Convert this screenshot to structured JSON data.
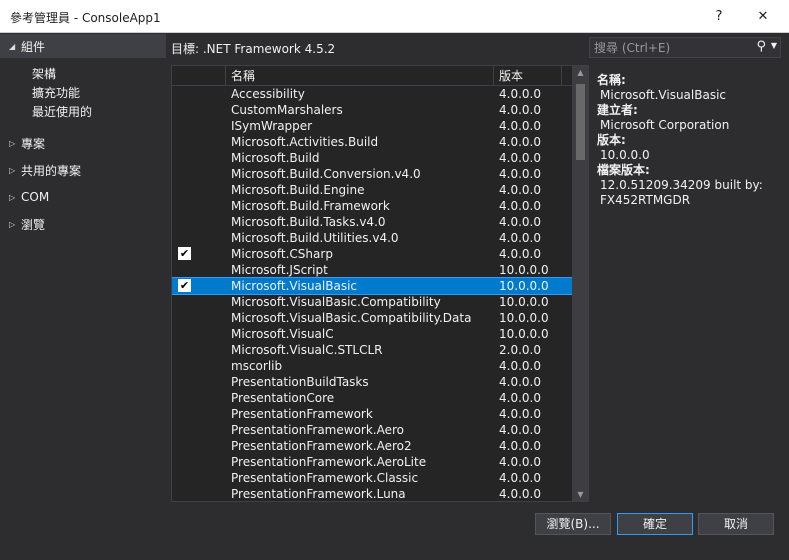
{
  "window": {
    "title": "參考管理員 - ConsoleApp1",
    "help_glyph": "?",
    "close_glyph": "✕"
  },
  "nav": {
    "assemblies": {
      "label": "組件",
      "arrow": "◢"
    },
    "sub_items": [
      "架構",
      "擴充功能",
      "最近使用的"
    ],
    "roots": [
      {
        "label": "專案",
        "arrow": "▷"
      },
      {
        "label": "共用的專案",
        "arrow": "▷"
      },
      {
        "label": "COM",
        "arrow": "▷"
      },
      {
        "label": "瀏覽",
        "arrow": "▷"
      }
    ]
  },
  "target": {
    "label": "目標: .NET Framework 4.5.2"
  },
  "search": {
    "placeholder": "搜尋 (Ctrl+E)",
    "icon_glyph": "⚲",
    "dropdown_glyph": "▼"
  },
  "list": {
    "headers": {
      "name": "名稱",
      "version": "版本"
    },
    "check_glyph": "✔",
    "rows": [
      {
        "name": "Accessibility",
        "version": "4.0.0.0",
        "checked": false,
        "selected": false
      },
      {
        "name": "CustomMarshalers",
        "version": "4.0.0.0",
        "checked": false,
        "selected": false
      },
      {
        "name": "ISymWrapper",
        "version": "4.0.0.0",
        "checked": false,
        "selected": false
      },
      {
        "name": "Microsoft.Activities.Build",
        "version": "4.0.0.0",
        "checked": false,
        "selected": false
      },
      {
        "name": "Microsoft.Build",
        "version": "4.0.0.0",
        "checked": false,
        "selected": false
      },
      {
        "name": "Microsoft.Build.Conversion.v4.0",
        "version": "4.0.0.0",
        "checked": false,
        "selected": false
      },
      {
        "name": "Microsoft.Build.Engine",
        "version": "4.0.0.0",
        "checked": false,
        "selected": false
      },
      {
        "name": "Microsoft.Build.Framework",
        "version": "4.0.0.0",
        "checked": false,
        "selected": false
      },
      {
        "name": "Microsoft.Build.Tasks.v4.0",
        "version": "4.0.0.0",
        "checked": false,
        "selected": false
      },
      {
        "name": "Microsoft.Build.Utilities.v4.0",
        "version": "4.0.0.0",
        "checked": false,
        "selected": false
      },
      {
        "name": "Microsoft.CSharp",
        "version": "4.0.0.0",
        "checked": true,
        "selected": false
      },
      {
        "name": "Microsoft.JScript",
        "version": "10.0.0.0",
        "checked": false,
        "selected": false
      },
      {
        "name": "Microsoft.VisualBasic",
        "version": "10.0.0.0",
        "checked": true,
        "selected": true
      },
      {
        "name": "Microsoft.VisualBasic.Compatibility",
        "version": "10.0.0.0",
        "checked": false,
        "selected": false
      },
      {
        "name": "Microsoft.VisualBasic.Compatibility.Data",
        "version": "10.0.0.0",
        "checked": false,
        "selected": false
      },
      {
        "name": "Microsoft.VisualC",
        "version": "10.0.0.0",
        "checked": false,
        "selected": false
      },
      {
        "name": "Microsoft.VisualC.STLCLR",
        "version": "2.0.0.0",
        "checked": false,
        "selected": false
      },
      {
        "name": "mscorlib",
        "version": "4.0.0.0",
        "checked": false,
        "selected": false
      },
      {
        "name": "PresentationBuildTasks",
        "version": "4.0.0.0",
        "checked": false,
        "selected": false
      },
      {
        "name": "PresentationCore",
        "version": "4.0.0.0",
        "checked": false,
        "selected": false
      },
      {
        "name": "PresentationFramework",
        "version": "4.0.0.0",
        "checked": false,
        "selected": false
      },
      {
        "name": "PresentationFramework.Aero",
        "version": "4.0.0.0",
        "checked": false,
        "selected": false
      },
      {
        "name": "PresentationFramework.Aero2",
        "version": "4.0.0.0",
        "checked": false,
        "selected": false
      },
      {
        "name": "PresentationFramework.AeroLite",
        "version": "4.0.0.0",
        "checked": false,
        "selected": false
      },
      {
        "name": "PresentationFramework.Classic",
        "version": "4.0.0.0",
        "checked": false,
        "selected": false
      },
      {
        "name": "PresentationFramework.Luna",
        "version": "4.0.0.0",
        "checked": false,
        "selected": false
      }
    ],
    "scroll_up_glyph": "▲",
    "scroll_down_glyph": "▼"
  },
  "details": {
    "name_label": "名稱:",
    "name_value": "Microsoft.VisualBasic",
    "creator_label": "建立者:",
    "creator_value": "Microsoft Corporation",
    "version_label": "版本:",
    "version_value": "10.0.0.0",
    "file_version_label": "檔案版本:",
    "file_version_line1": "12.0.51209.34209 built by:",
    "file_version_line2": "FX452RTMGDR"
  },
  "buttons": {
    "browse": "瀏覽(B)...",
    "ok": "確定",
    "cancel": "取消"
  },
  "colors": {
    "background": "#2d2d30",
    "list_background": "#252526",
    "selection": "#007acc",
    "text": "#f1f1f1"
  },
  "icons": {
    "search": "search-icon",
    "check": "check-icon",
    "expand": "chevron-right-icon",
    "expanded": "chevron-down-icon"
  }
}
